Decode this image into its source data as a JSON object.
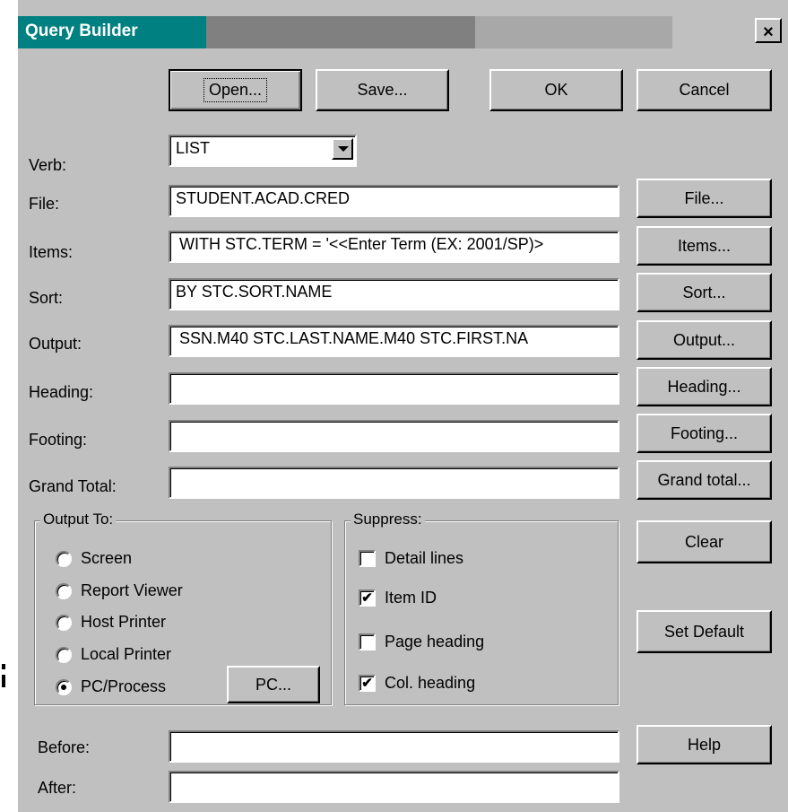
{
  "window": {
    "title": "Query Builder",
    "close_glyph": "×"
  },
  "toolbar": {
    "open": "Open...",
    "save": "Save...",
    "ok": "OK",
    "cancel": "Cancel"
  },
  "fields": {
    "verb": {
      "label": "Verb:",
      "value": "LIST"
    },
    "file": {
      "label": "File:",
      "value": "STUDENT.ACAD.CRED",
      "button": "File..."
    },
    "items": {
      "label": "Items:",
      "value": "WITH STC.TERM = '<<Enter Term (EX: 2001/SP)>",
      "button": "Items..."
    },
    "sort": {
      "label": "Sort:",
      "value": "BY STC.SORT.NAME",
      "button": "Sort..."
    },
    "output": {
      "label": "Output:",
      "value": "SSN.M40  STC.LAST.NAME.M40  STC.FIRST.NA",
      "button": "Output..."
    },
    "heading": {
      "label": "Heading:",
      "value": "",
      "button": "Heading..."
    },
    "footing": {
      "label": "Footing:",
      "value": "",
      "button": "Footing..."
    },
    "grand_total": {
      "label": "Grand Total:",
      "value": "",
      "button": "Grand total..."
    }
  },
  "output_to": {
    "title": "Output To:",
    "options": [
      "Screen",
      "Report Viewer",
      "Host Printer",
      "Local Printer",
      "PC/Process"
    ],
    "selected": "PC/Process",
    "pc_button": "PC..."
  },
  "suppress": {
    "title": "Suppress:",
    "options": [
      {
        "label": "Detail lines",
        "checked": false
      },
      {
        "label": "Item ID",
        "checked": true
      },
      {
        "label": "Page heading",
        "checked": false
      },
      {
        "label": "Col. heading",
        "checked": true
      }
    ]
  },
  "side_buttons": {
    "clear": "Clear",
    "set_default": "Set Default",
    "help": "Help"
  },
  "bottom": {
    "before": {
      "label": "Before:",
      "value": ""
    },
    "after": {
      "label": "After:",
      "value": ""
    }
  }
}
